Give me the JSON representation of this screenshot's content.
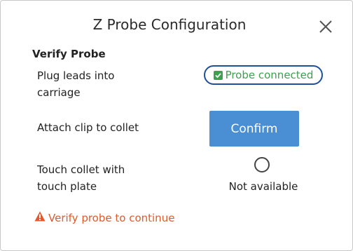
{
  "dialog": {
    "title": "Z Probe Configuration",
    "close_icon": "close-icon"
  },
  "verify": {
    "section_title": "Verify Probe",
    "steps": [
      {
        "label": "Plug leads into carriage"
      },
      {
        "label": "Attach clip to collet"
      },
      {
        "label": "Touch collet with touch plate"
      }
    ],
    "probe_status": {
      "text": "Probe connected",
      "icon": "checkbox-checked-icon",
      "color": "#3fa04f",
      "border_color": "#1d4f9c"
    },
    "confirm_button": {
      "label": "Confirm",
      "color": "#4a8ed4"
    },
    "touch_status": {
      "icon": "radio-empty-icon",
      "text": "Not available"
    },
    "warning": {
      "icon": "warning-triangle-icon",
      "text": "Verify probe to continue",
      "color": "#e05a2b"
    }
  }
}
